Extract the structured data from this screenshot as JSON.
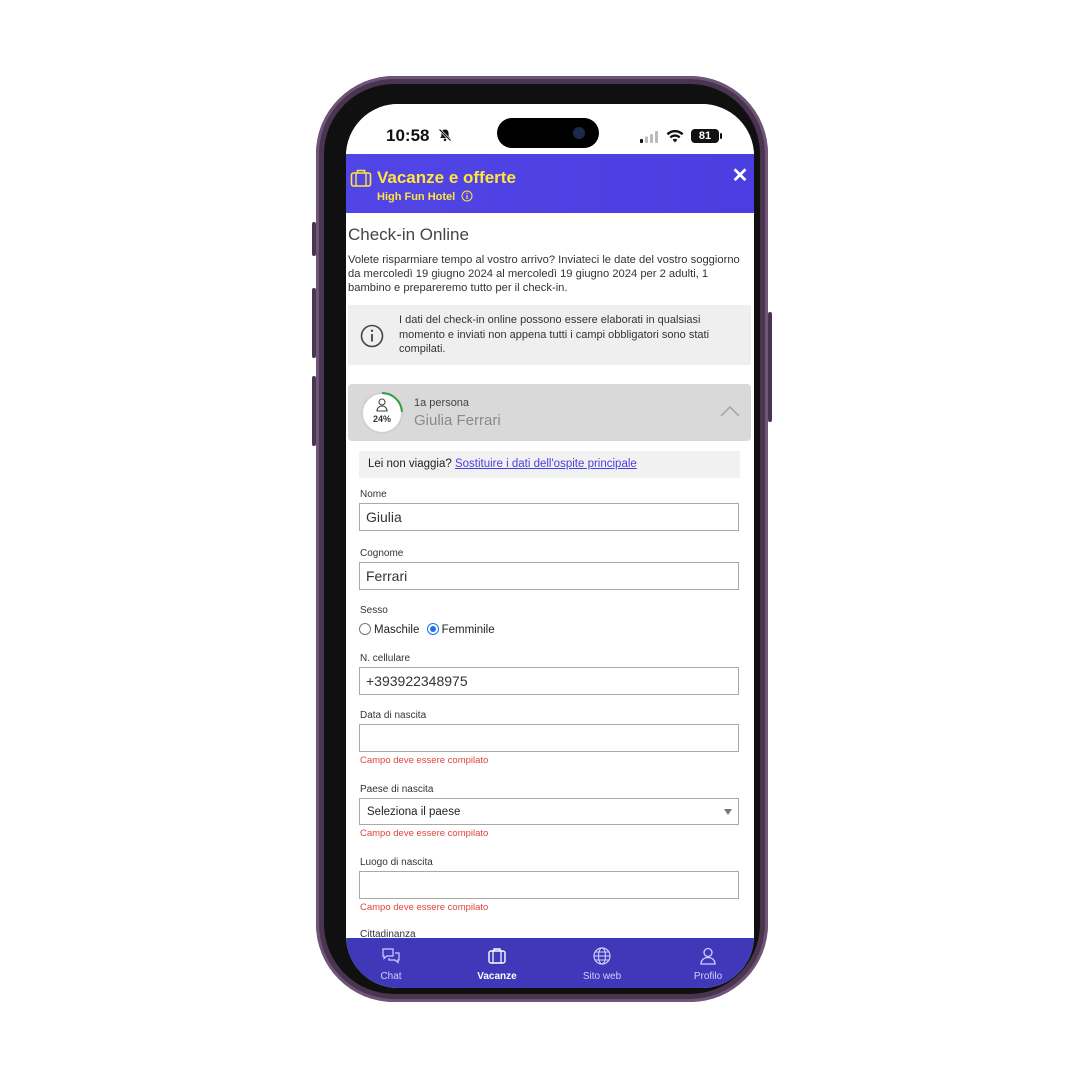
{
  "status_bar": {
    "time": "10:58",
    "battery": "81"
  },
  "header": {
    "title": "Vacanze e offerte",
    "subtitle": "High Fun Hotel",
    "close": "✕"
  },
  "page": {
    "title": "Check-in Online",
    "intro": "Volete risparmiare tempo al vostro arrivo? Inviateci le date del vostro soggiorno da mercoledì 19 giugno 2024 al mercoledì 19 giugno 2024 per 2 adulti, 1 bambino e prepareremo tutto per il check-in.",
    "notice": "I dati del check-in online possono essere elaborati in qualsiasi momento e inviati non appena tutti i campi obbligatori sono stati compilati."
  },
  "person": {
    "label": "1a persona",
    "name": "Giulia Ferrari",
    "progress": 24,
    "progress_label": "24%"
  },
  "replace": {
    "question": "Lei non viaggia?",
    "link": "Sostituire i dati dell'ospite principale"
  },
  "form": {
    "nome_label": "Nome",
    "nome_value": "Giulia",
    "cognome_label": "Cognome",
    "cognome_value": "Ferrari",
    "sesso_label": "Sesso",
    "sesso_options": [
      "Maschile",
      "Femminile"
    ],
    "sesso_selected": "Femminile",
    "cellulare_label": "N. cellulare",
    "cellulare_value": "+393922348975",
    "nascita_label": "Data di nascita",
    "nascita_value": "",
    "paese_label": "Paese di nascita",
    "paese_value": "Seleziona il paese",
    "luogo_label": "Luogo di nascita",
    "luogo_value": "",
    "error": "Campo deve essere compilato",
    "next_label": "Cittadinanza"
  },
  "nav": {
    "chat": "Chat",
    "vacanze": "Vacanze",
    "sito": "Sito web",
    "profilo": "Profilo"
  },
  "colors": {
    "header": "#5145e6",
    "accent_text": "#ffe63c",
    "nav": "#3f38b8",
    "error": "#e0443e",
    "progress": "#2e9e3e"
  }
}
